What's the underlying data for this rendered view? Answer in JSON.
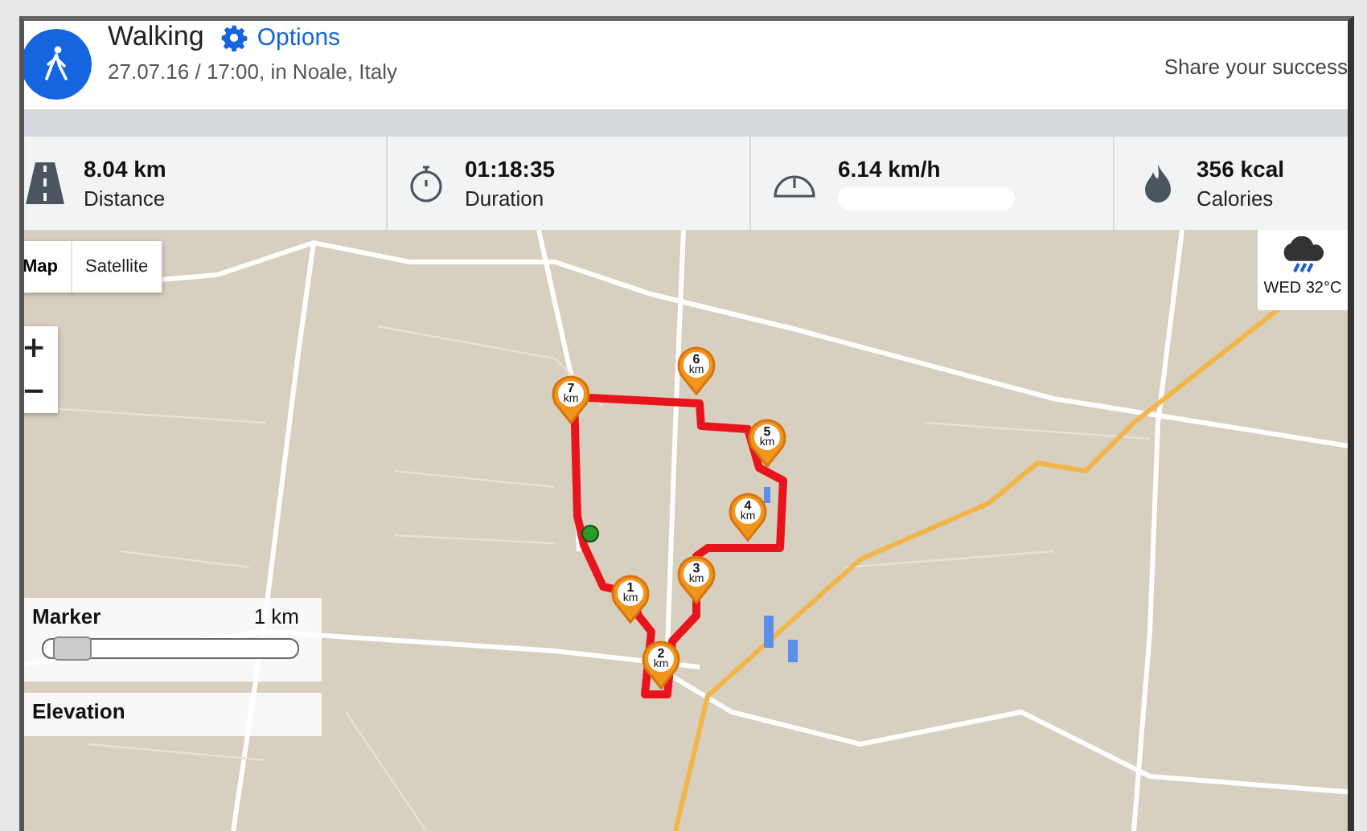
{
  "header": {
    "activity": "Walking",
    "options_link": "Options",
    "subtitle": "27.07.16 / 17:00, in Noale, Italy",
    "share": "Share your success"
  },
  "stats": [
    {
      "kind": "distance",
      "value": "8.04 km",
      "label": "Distance",
      "blurred": false
    },
    {
      "kind": "duration",
      "value": "01:18:35",
      "label": "Duration",
      "blurred": false
    },
    {
      "kind": "speed",
      "value": "6.14 km/h",
      "blurred": true
    },
    {
      "kind": "calories",
      "value": "356 kcal",
      "label": "Calories",
      "blurred": false
    }
  ],
  "map": {
    "type_buttons": [
      {
        "label": "Map",
        "selected": true
      },
      {
        "label": "Satellite",
        "selected": false
      }
    ],
    "zoom_buttons": [
      "+",
      "−"
    ],
    "weather": {
      "forecast": "WED 32°C"
    },
    "km_markers": [
      {
        "number": "1",
        "unit": "km"
      },
      {
        "number": "2",
        "unit": "km"
      },
      {
        "number": "3",
        "unit": "km"
      },
      {
        "number": "4",
        "unit": "km"
      },
      {
        "number": "5",
        "unit": "km"
      },
      {
        "number": "6",
        "unit": "km"
      },
      {
        "number": "7",
        "unit": "km"
      }
    ],
    "marker_panel": {
      "label": "Marker",
      "reading": "1 km",
      "level": 0.04
    },
    "elevation_panel": {
      "label": "Elevation"
    }
  }
}
